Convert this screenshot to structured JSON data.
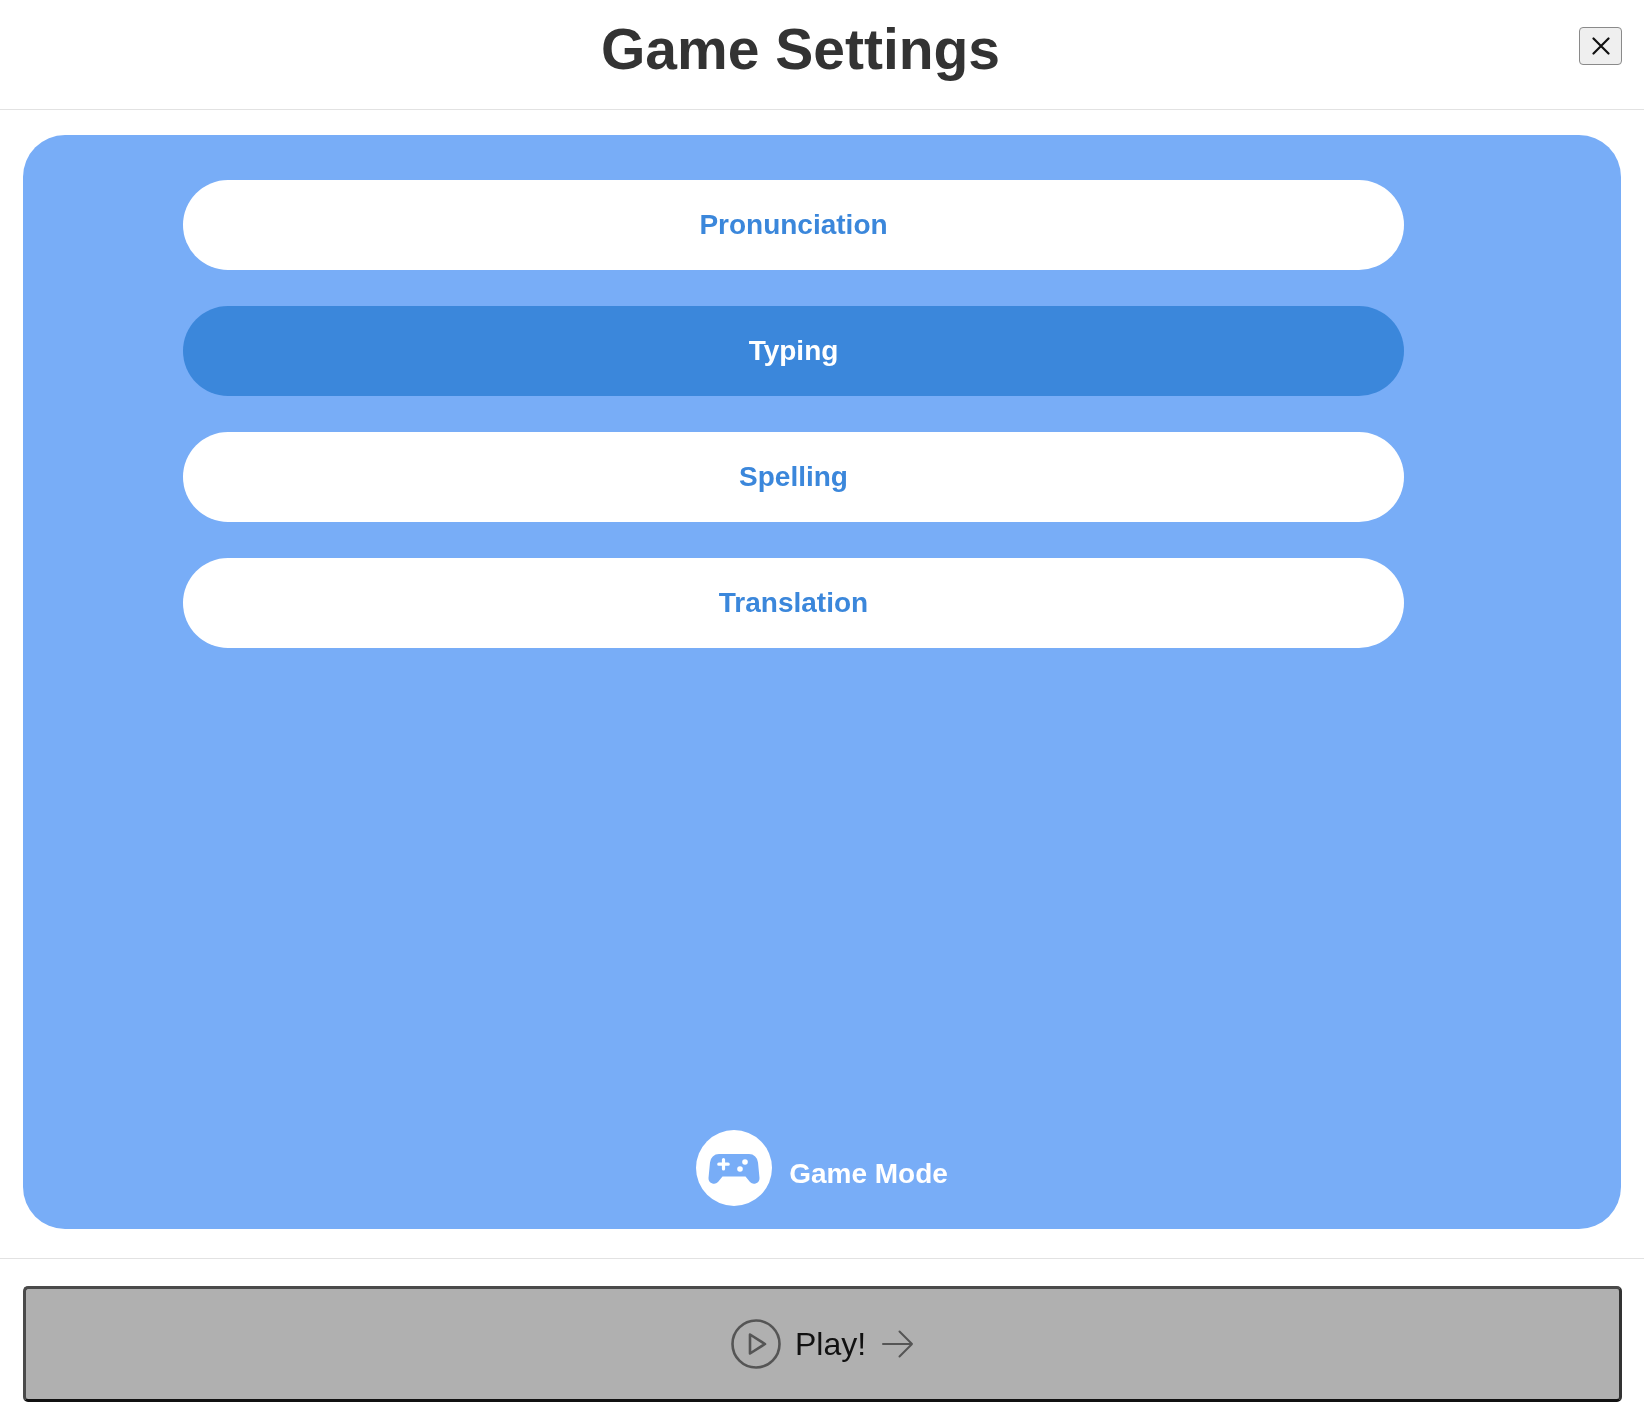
{
  "header": {
    "title": "Game Settings"
  },
  "modes": [
    {
      "label": "Pronunciation",
      "selected": false
    },
    {
      "label": "Typing",
      "selected": true
    },
    {
      "label": "Spelling",
      "selected": false
    },
    {
      "label": "Translation",
      "selected": false
    }
  ],
  "panel_footer": {
    "label": "Game Mode"
  },
  "play_button": {
    "label": "Play!"
  }
}
